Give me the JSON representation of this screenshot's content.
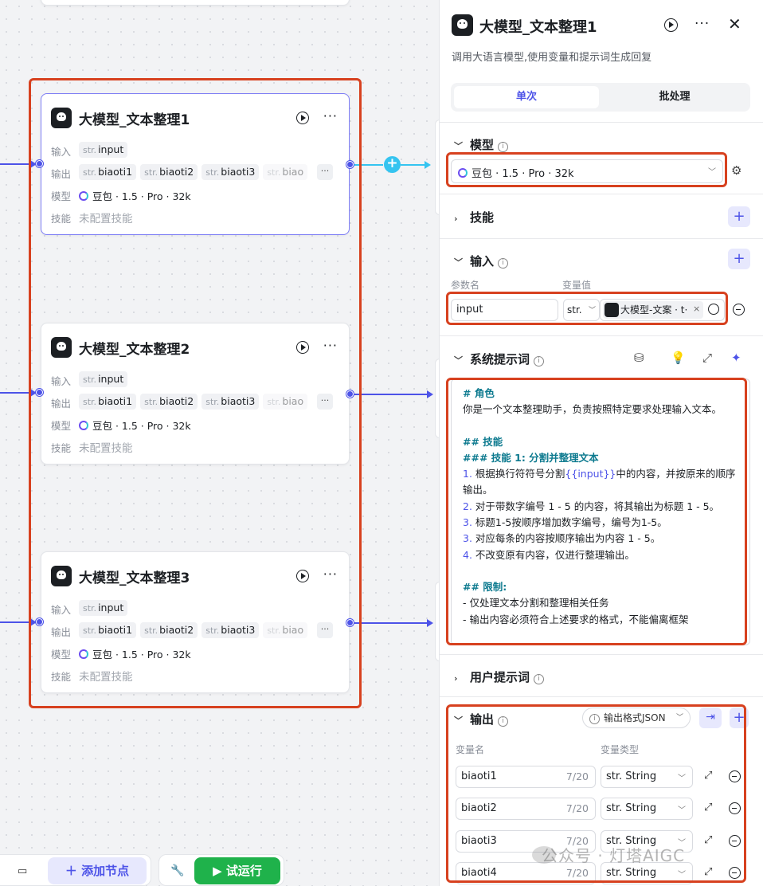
{
  "nodes": [
    {
      "title": "大模型_文本整理1",
      "input_label": "输入",
      "output_label": "输出",
      "model_label": "模型",
      "skill_label": "技能",
      "type_prefix": "str.",
      "input": "input",
      "outputs": [
        "biaoti1",
        "biaoti2",
        "biaoti3",
        "biao"
      ],
      "model": "豆包 · 1.5 · Pro · 32k",
      "skill": "未配置技能"
    },
    {
      "title": "大模型_文本整理2",
      "input_label": "输入",
      "output_label": "输出",
      "model_label": "模型",
      "skill_label": "技能",
      "type_prefix": "str.",
      "input": "input",
      "outputs": [
        "biaoti1",
        "biaoti2",
        "biaoti3",
        "biao"
      ],
      "model": "豆包 · 1.5 · Pro · 32k",
      "skill": "未配置技能"
    },
    {
      "title": "大模型_文本整理3",
      "input_label": "输入",
      "output_label": "输出",
      "model_label": "模型",
      "skill_label": "技能",
      "type_prefix": "str.",
      "input": "input",
      "outputs": [
        "biaoti1",
        "biaoti2",
        "biaoti3",
        "biao"
      ],
      "model": "豆包 · 1.5 · Pro · 32k",
      "skill": "未配置技能"
    }
  ],
  "toolbar": {
    "add_node": "添加节点",
    "run": "试运行"
  },
  "panel": {
    "title": "大模型_文本整理1",
    "description": "调用大语言模型,使用变量和提示词生成回复",
    "tabs": {
      "single": "单次",
      "batch": "批处理"
    },
    "model_section": "模型",
    "model_value": "豆包 · 1.5 · Pro · 32k",
    "skills_section": "技能",
    "input_section": "输入",
    "param_name_label": "参数名",
    "var_value_label": "变量值",
    "input_param": "input",
    "input_type": "str.",
    "input_ref": "大模型-文案 · t·",
    "system_prompt_section": "系统提示词",
    "prompt_lines": {
      "l1": "# 角色",
      "l2": "你是一个文本整理助手，负责按照特定要求处理输入文本。",
      "l3": "## 技能",
      "l4": "### 技能 1: 分割并整理文本",
      "l5a": "1.",
      "l5b": " 根据换行符符号分割",
      "l5c": "{{input}}",
      "l5d": "中的内容，并按原来的顺序输出。",
      "l6a": "2.",
      "l6b": " 对于带数字编号 1 - 5 的内容，将其输出为标题 1 - 5。",
      "l7a": "3.",
      "l7b": " 标题1-5按顺序增加数字编号，编号为1-5。",
      "l8a": "3.",
      "l8b": " 对应每条的内容按顺序输出为内容 1 - 5。",
      "l9a": "4.",
      "l9b": " 不改变原有内容，仅进行整理输出。",
      "l10": "## 限制:",
      "l11": "- 仅处理文本分割和整理相关任务",
      "l12": "- 输出内容必须符合上述要求的格式，不能偏离框架"
    },
    "user_prompt_section": "用户提示词",
    "output_section": "输出",
    "output_format": "输出格式JSON",
    "var_name_label": "变量名",
    "var_type_label": "变量类型",
    "outputs": [
      {
        "name": "biaoti1",
        "count": "7/20",
        "type": "str. String"
      },
      {
        "name": "biaoti2",
        "count": "7/20",
        "type": "str. String"
      },
      {
        "name": "biaoti3",
        "count": "7/20",
        "type": "str. String"
      },
      {
        "name": "biaoti4",
        "count": "7/20",
        "type": "str. String"
      }
    ]
  },
  "watermark": "公众号 · 灯塔AIGC",
  "colors": {
    "accent": "#4d53e8",
    "highlight": "#d7411f",
    "run": "#1fb24b",
    "edge": "#4d53e8"
  }
}
